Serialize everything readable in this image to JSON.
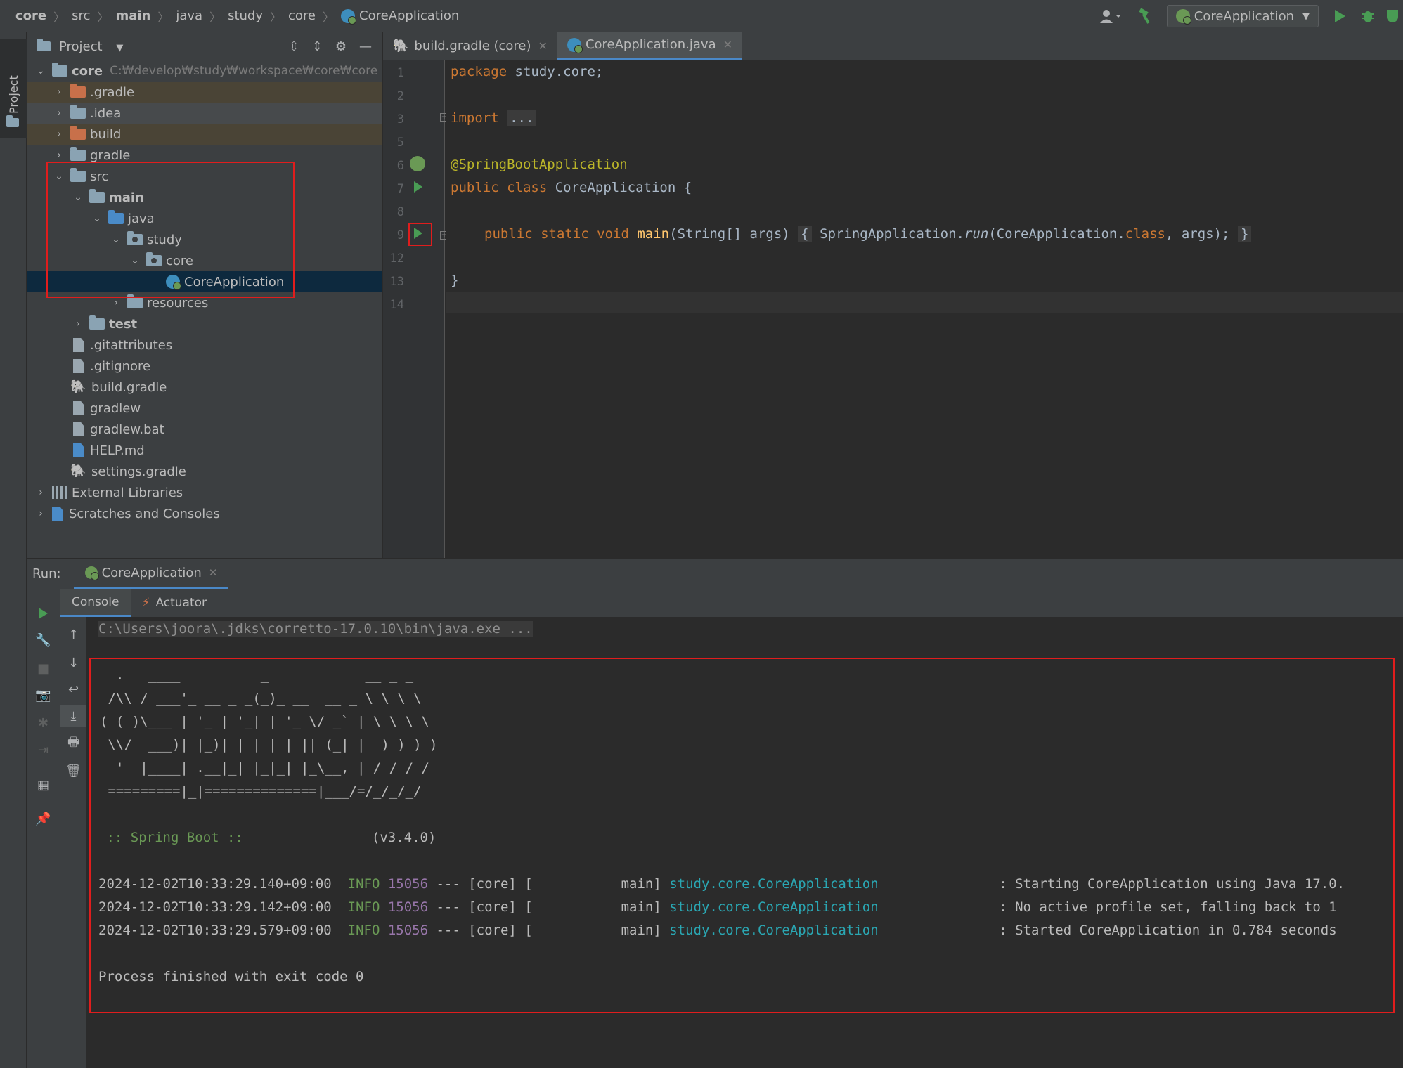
{
  "breadcrumbs": [
    "core",
    "src",
    "main",
    "java",
    "study",
    "core",
    "CoreApplication"
  ],
  "toolbar": {
    "run_config": "CoreApplication"
  },
  "left_strip": {
    "project_tab": "Project"
  },
  "project_panel": {
    "title": "Project",
    "root": {
      "name": "core",
      "path": "C:₩develop₩study₩workspace₩core₩core"
    },
    "items": [
      ".gradle",
      ".idea",
      "build",
      "gradle",
      "src",
      "main",
      "java",
      "study",
      "core",
      "CoreApplication",
      "resources",
      "test",
      ".gitattributes",
      ".gitignore",
      "build.gradle",
      "gradlew",
      "gradlew.bat",
      "HELP.md",
      "settings.gradle",
      "External Libraries",
      "Scratches and Consoles"
    ]
  },
  "editor": {
    "tabs": [
      "build.gradle (core)",
      "CoreApplication.java"
    ],
    "line_numbers": [
      "1",
      "2",
      "3",
      "5",
      "6",
      "7",
      "8",
      "9",
      "12",
      "13",
      "14"
    ],
    "code": {
      "l1_kw": "package",
      "l1_rest": " study.core;",
      "l3_kw": "import",
      "l3_fold": "...",
      "l6_ann": "@SpringBootApplication",
      "l7_kw": "public class",
      "l7_rest": " CoreApplication {",
      "l9_kw": "public static void",
      "l9_fn": "main",
      "l9_args": "(String[] args)",
      "l9_open": "{",
      "l9_body1": " SpringApplication.",
      "l9_run": "run",
      "l9_body2": "(CoreApplication.",
      "l9_class": "class",
      "l9_body3": ", args);",
      "l9_close": "}",
      "l13": "}"
    }
  },
  "run_window": {
    "label": "Run:",
    "tab": "CoreApplication",
    "subtabs": [
      "Console",
      "Actuator"
    ]
  },
  "console": {
    "command": "C:\\Users\\joora\\.jdks\\corretto-17.0.10\\bin\\java.exe ...",
    "banner": [
      "  .   ____          _            __ _ _",
      " /\\\\ / ___'_ __ _ _(_)_ __  __ _ \\ \\ \\ \\",
      "( ( )\\___ | '_ | '_| | '_ \\/ _` | \\ \\ \\ \\",
      " \\\\/  ___)| |_)| | | | | || (_| |  ) ) ) )",
      "  '  |____| .__|_| |_|_| |_\\__, | / / / /",
      " =========|_|==============|___/=/_/_/_/"
    ],
    "spring_label": " :: Spring Boot :: ",
    "spring_version": "               (v3.4.0)",
    "logs": [
      {
        "ts": "2024-12-02T10:33:29.140+09:00",
        "level": "INFO",
        "pid": "15056",
        "mid": " --- [core] [           main] ",
        "logger": "study.core.CoreApplication",
        "msg": "               : Starting CoreApplication using Java 17.0."
      },
      {
        "ts": "2024-12-02T10:33:29.142+09:00",
        "level": "INFO",
        "pid": "15056",
        "mid": " --- [core] [           main] ",
        "logger": "study.core.CoreApplication",
        "msg": "               : No active profile set, falling back to 1"
      },
      {
        "ts": "2024-12-02T10:33:29.579+09:00",
        "level": "INFO",
        "pid": "15056",
        "mid": " --- [core] [           main] ",
        "logger": "study.core.CoreApplication",
        "msg": "               : Started CoreApplication in 0.784 seconds"
      }
    ],
    "exit": "Process finished with exit code 0"
  },
  "colors": {
    "accent": "#4a88c7",
    "highlight_box": "#e01d1d",
    "run_green": "#499c54"
  }
}
